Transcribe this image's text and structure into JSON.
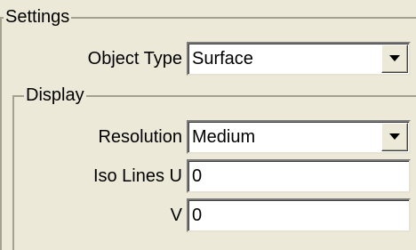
{
  "settings": {
    "group_label": "Settings",
    "object_type": {
      "label": "Object Type",
      "value": "Surface"
    }
  },
  "display": {
    "group_label": "Display",
    "resolution": {
      "label": "Resolution",
      "value": "Medium"
    },
    "iso_lines_u": {
      "label": "Iso Lines U",
      "value": "0"
    },
    "iso_lines_v": {
      "label": "V",
      "value": "0"
    }
  },
  "icons": {
    "dropdown": "chevron-down-icon"
  },
  "colors": {
    "panel_background": "#ece9d8",
    "field_background": "#ffffff",
    "groove": "#a5a18f"
  }
}
